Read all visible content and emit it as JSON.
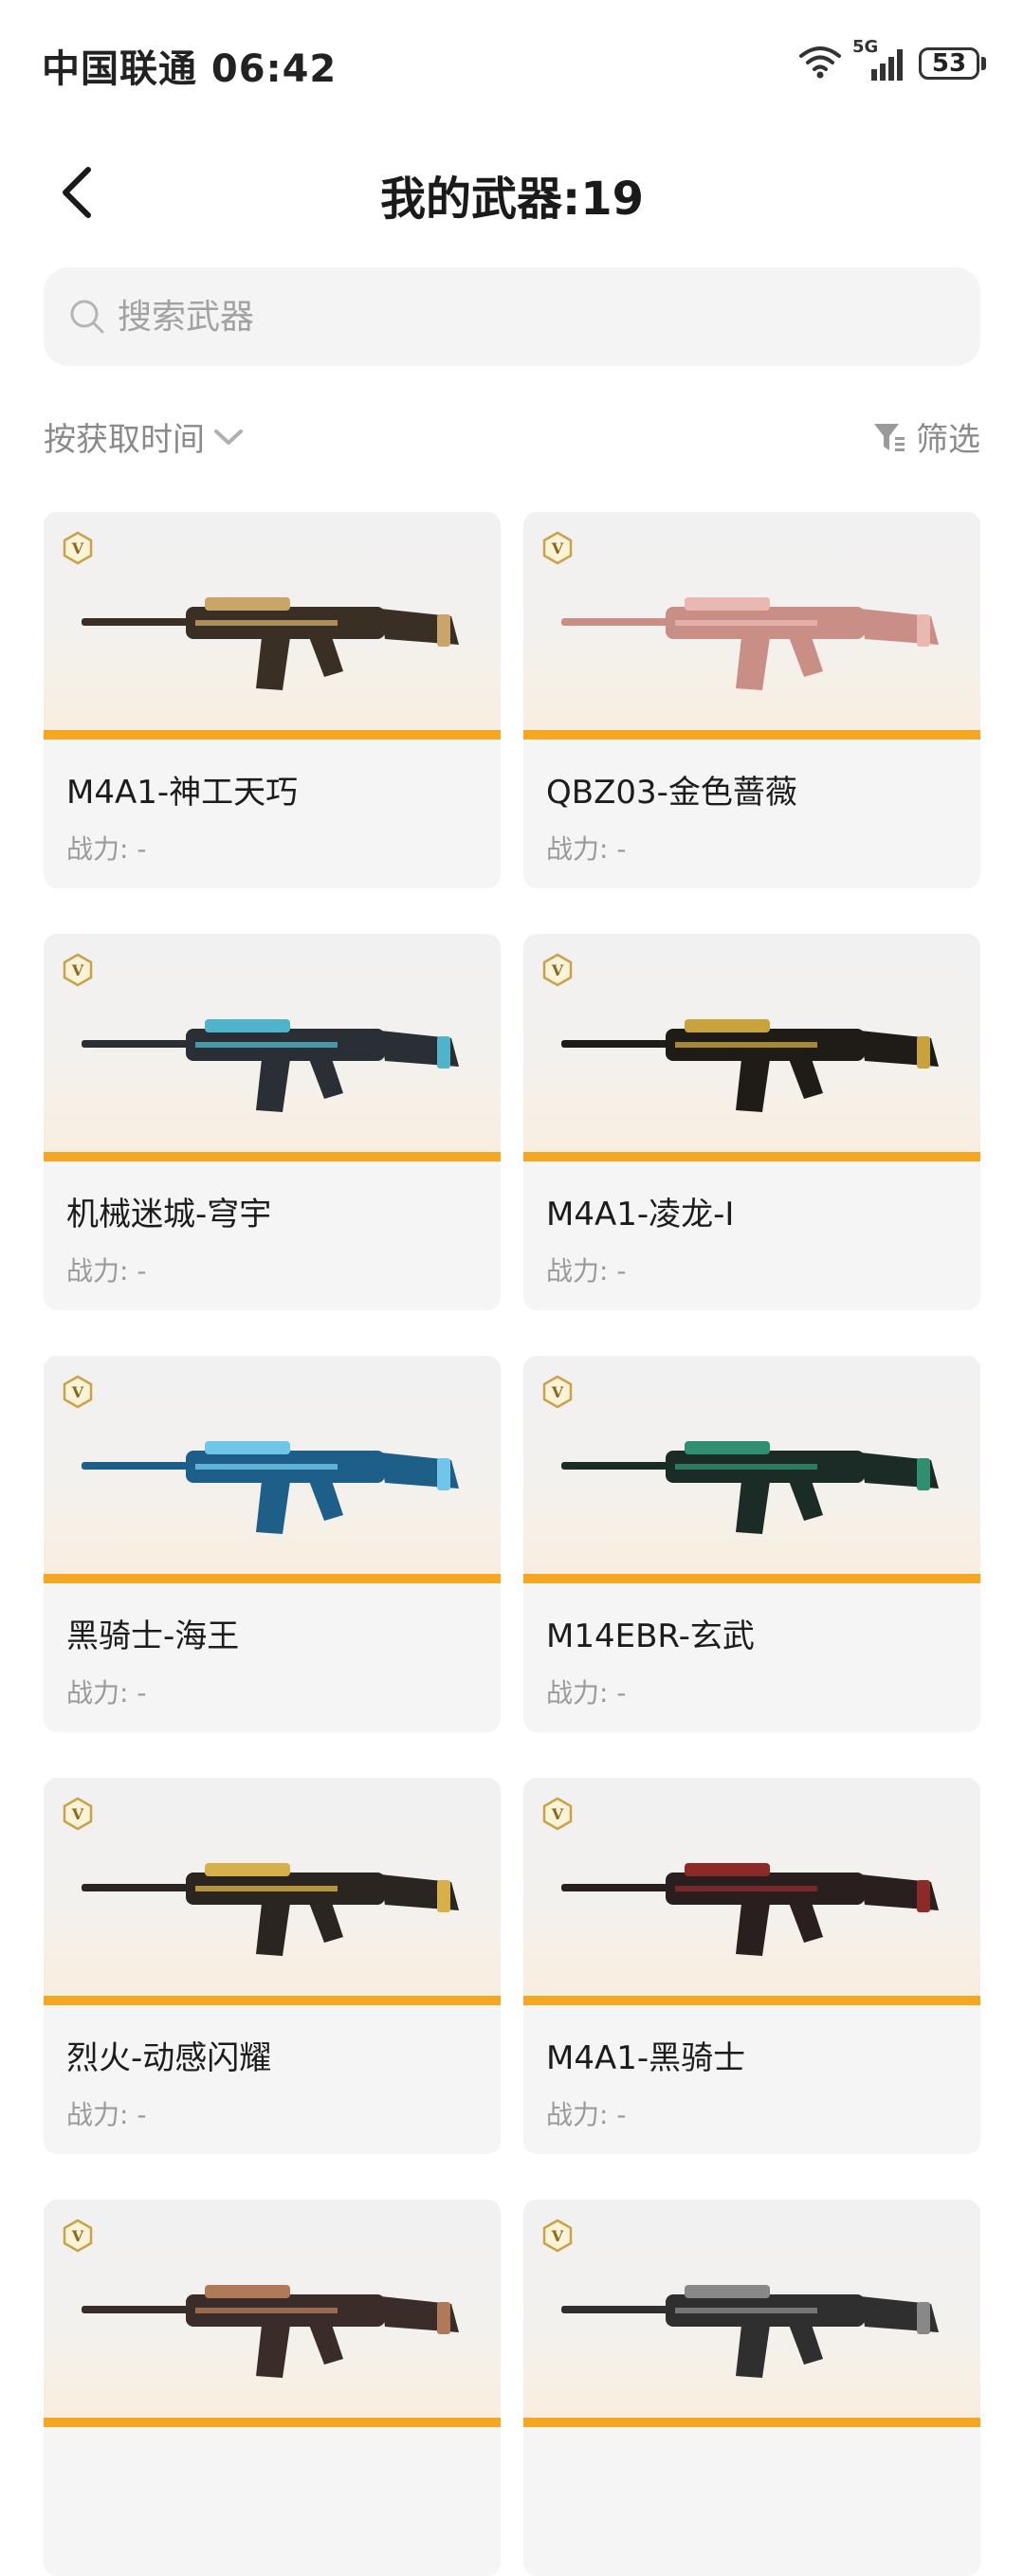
{
  "status_bar": {
    "carrier_time": "中国联通 06:42",
    "network": "5G",
    "battery": "53"
  },
  "header": {
    "title": "我的武器:19"
  },
  "search": {
    "placeholder": "搜索武器"
  },
  "toolbar": {
    "sort_label": "按获取时间",
    "filter_label": "筛选"
  },
  "colors": {
    "accent": "#f5a623",
    "card_bg": "#f5f5f6",
    "muted_text": "#9a9a9a"
  },
  "weapons": [
    {
      "name": "M4A1-神工天巧",
      "power": "战力: -",
      "badge": "V",
      "body": "#3a2f24",
      "accent": "#c9a56a"
    },
    {
      "name": "QBZ03-金色蔷薇",
      "power": "战力: -",
      "badge": "V",
      "body": "#c98e86",
      "accent": "#e9b8b1"
    },
    {
      "name": "机械迷城-穹宇",
      "power": "战力: -",
      "badge": "V",
      "body": "#2a2f36",
      "accent": "#4fb3c9"
    },
    {
      "name": "M4A1-凌龙-I",
      "power": "战力: -",
      "badge": "V",
      "body": "#1f1c18",
      "accent": "#c8a23b"
    },
    {
      "name": "黑骑士-海王",
      "power": "战力: -",
      "badge": "V",
      "body": "#1e5f8a",
      "accent": "#6fc6e8"
    },
    {
      "name": "M14EBR-玄武",
      "power": "战力: -",
      "badge": "V",
      "body": "#1b2b26",
      "accent": "#2f8f70"
    },
    {
      "name": "烈火-动感闪耀",
      "power": "战力: -",
      "badge": "V",
      "body": "#2a2520",
      "accent": "#d8b04a"
    },
    {
      "name": "M4A1-黑骑士",
      "power": "战力: -",
      "badge": "V",
      "body": "#2a1f1f",
      "accent": "#8c2a2a"
    },
    {
      "name": "",
      "power": "",
      "badge": "V",
      "body": "#3a2c28",
      "accent": "#b07a5a"
    },
    {
      "name": "",
      "power": "",
      "badge": "V",
      "body": "#2f2f2f",
      "accent": "#888888"
    }
  ]
}
